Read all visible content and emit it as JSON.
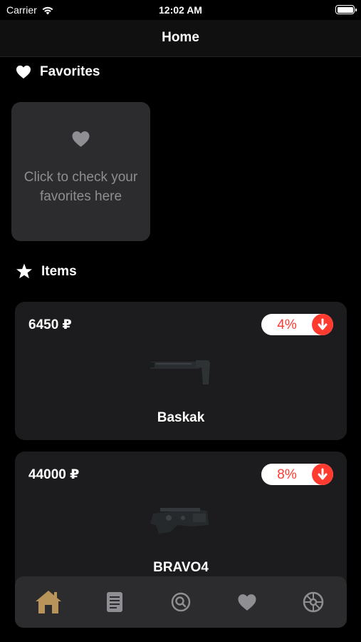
{
  "status_bar": {
    "carrier": "Carrier",
    "time": "12:02 AM"
  },
  "nav": {
    "title": "Home"
  },
  "favorites": {
    "header": "Favorites",
    "card_text": "Click to check your favorites here"
  },
  "items": {
    "header": "Items",
    "list": [
      {
        "price": "6450 ₽",
        "discount": "4%",
        "name": "Baskak"
      },
      {
        "price": "44000 ₽",
        "discount": "8%",
        "name": "BRAVO4"
      }
    ]
  },
  "tabs": [
    "home-icon",
    "list-icon",
    "search-icon",
    "heart-icon",
    "settings-icon"
  ],
  "colors": {
    "background": "#000000",
    "card": "#1c1c1e",
    "favorites_card": "#2c2c2e",
    "tab_bar": "#2c2c2e",
    "active_tab": "#b8935a",
    "inactive_tab": "#8e8e93",
    "discount_red": "#ff3b30"
  }
}
